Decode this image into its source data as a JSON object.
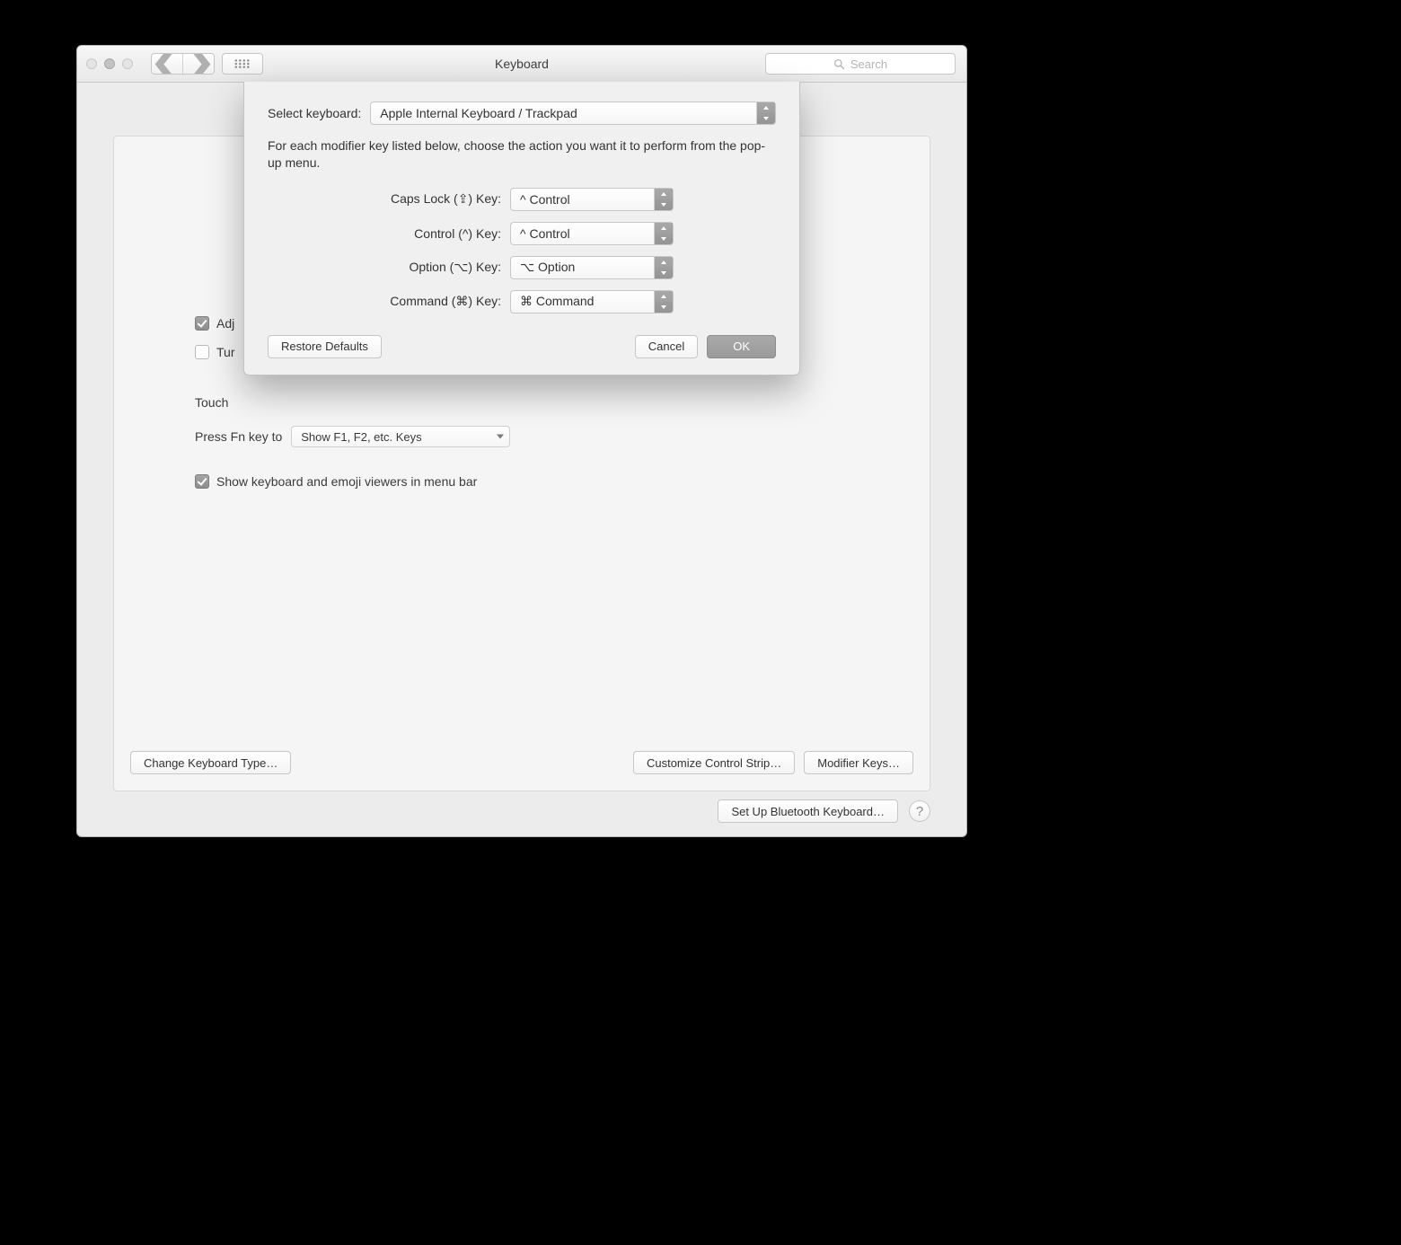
{
  "window": {
    "title": "Keyboard",
    "search_placeholder": "Search"
  },
  "main": {
    "checkbox_adjust_partial": "Adj",
    "checkbox_turn_partial": "Tur",
    "touch_partial": "Touch",
    "fn_label": "Press Fn key to",
    "fn_value": "Show F1, F2, etc. Keys",
    "show_viewers": "Show keyboard and emoji viewers in menu bar",
    "btn_change_type": "Change Keyboard Type…",
    "btn_customize": "Customize Control Strip…",
    "btn_modifier": "Modifier Keys…",
    "btn_bluetooth": "Set Up Bluetooth Keyboard…"
  },
  "sheet": {
    "select_label": "Select keyboard:",
    "select_value": "Apple Internal Keyboard / Trackpad",
    "explain": "For each modifier key listed below, choose the action you want it to perform from the pop-up menu.",
    "rows": {
      "caps": {
        "label": "Caps Lock (⇪) Key:",
        "value": "^ Control"
      },
      "control": {
        "label": "Control (^) Key:",
        "value": "^ Control"
      },
      "option": {
        "label": "Option (⌥) Key:",
        "value": "⌥ Option"
      },
      "command": {
        "label": "Command (⌘) Key:",
        "value": "⌘ Command"
      }
    },
    "restore": "Restore Defaults",
    "cancel": "Cancel",
    "ok": "OK"
  }
}
